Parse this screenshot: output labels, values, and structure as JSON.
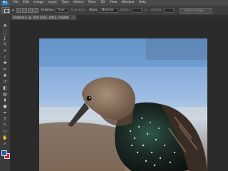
{
  "app": {
    "logo": "Ps"
  },
  "menu": [
    "File",
    "Edit",
    "Image",
    "Layer",
    "Type",
    "Select",
    "Filter",
    "3D",
    "View",
    "Window",
    "Help"
  ],
  "options": {
    "feather_label": "Feather:",
    "feather_value": "0 px",
    "antialias_label": "Anti-alias",
    "style_label": "Style:",
    "style_value": "Normal",
    "width_label": "Width:",
    "height_label": "Height:",
    "refine_label": "Refine Edge..."
  },
  "document_tab": {
    "title": "Untitled-1 @ 16% (DSC_0052, RGB/8)",
    "close": "×"
  },
  "toolbar": {
    "icons": [
      "move-icon",
      "marquee-icon",
      "lasso-icon",
      "quick-select-icon",
      "crop-icon",
      "eyedropper-icon",
      "healing-icon",
      "brush-icon",
      "clone-stamp-icon",
      "history-brush-icon",
      "eraser-icon",
      "gradient-icon",
      "blur-icon",
      "dodge-icon",
      "pen-icon",
      "type-icon",
      "path-select-icon",
      "shape-icon",
      "hand-icon",
      "zoom-icon"
    ],
    "glyphs": [
      "✥",
      "⬚",
      "ʆ",
      "✎",
      "⌗",
      "⁄",
      "✚",
      "✏",
      "♣",
      "↺",
      "◧",
      "▤",
      "◖",
      "●",
      "✒",
      "T",
      "↖",
      "▭",
      "✋",
      "⌕"
    ]
  },
  "colors": {
    "foreground": "#2a56c6",
    "background": "#d0262a",
    "workspace": "#2b2b2b"
  }
}
